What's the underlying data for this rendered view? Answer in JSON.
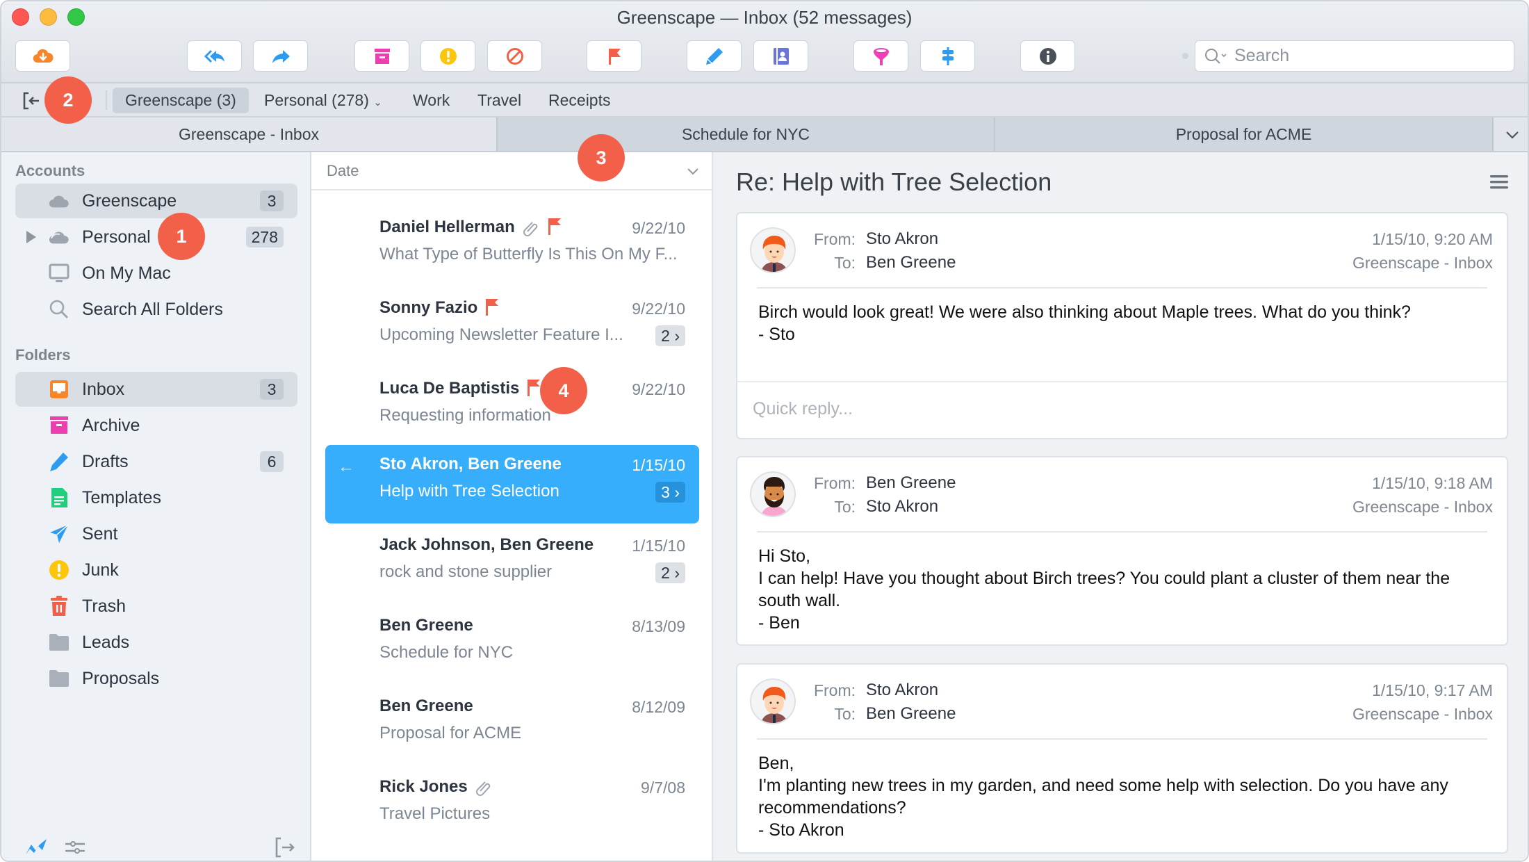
{
  "window": {
    "title": "Greenscape — Inbox (52 messages)"
  },
  "toolbar": {
    "buttons": [
      {
        "name": "get-mail",
        "icon": "cloud-download-icon",
        "color": "#f7862a"
      },
      {
        "name": "reply-all",
        "icon": "reply-all-icon",
        "color": "#2d9cf0"
      },
      {
        "name": "forward",
        "icon": "forward-icon",
        "color": "#2d9cf0"
      },
      {
        "name": "archive",
        "icon": "archive-icon",
        "color": "#ee3fb0"
      },
      {
        "name": "junk",
        "icon": "junk-icon",
        "color": "#fdc60a"
      },
      {
        "name": "block",
        "icon": "block-icon",
        "color": "#f2604a"
      },
      {
        "name": "flag",
        "icon": "flag-icon",
        "color": "#f2604a"
      },
      {
        "name": "compose",
        "icon": "pencil-icon",
        "color": "#2d9cf0"
      },
      {
        "name": "contacts",
        "icon": "contacts-icon",
        "color": "#6a75dc"
      },
      {
        "name": "filter",
        "icon": "filter-icon",
        "color": "#f040b8"
      },
      {
        "name": "tags",
        "icon": "signpost-icon",
        "color": "#2d9cf0"
      },
      {
        "name": "info",
        "icon": "info-icon",
        "color": "#4a5058"
      }
    ],
    "search_placeholder": "Search"
  },
  "favorites": {
    "items": [
      {
        "label": "Greenscape (3)",
        "active": true
      },
      {
        "label": "Personal (278)",
        "dropdown": true
      },
      {
        "label": "Work"
      },
      {
        "label": "Travel"
      },
      {
        "label": "Receipts"
      }
    ]
  },
  "tabs": [
    {
      "label": "Greenscape - Inbox",
      "active": true
    },
    {
      "label": "Schedule for NYC"
    },
    {
      "label": "Proposal for ACME"
    }
  ],
  "sidebar": {
    "accounts_header": "Accounts",
    "accounts": [
      {
        "label": "Greenscape",
        "count": "3",
        "selected": true,
        "icon": "cloud-icon"
      },
      {
        "label": "Personal",
        "count": "278",
        "icon": "cloud-icon",
        "expandable": true
      },
      {
        "label": "On My Mac",
        "icon": "computer-icon"
      },
      {
        "label": "Search All Folders",
        "icon": "search-icon"
      }
    ],
    "folders_header": "Folders",
    "folders": [
      {
        "label": "Inbox",
        "count": "3",
        "selected": true,
        "icon": "inbox-icon"
      },
      {
        "label": "Archive",
        "icon": "archive-icon"
      },
      {
        "label": "Drafts",
        "count": "6",
        "icon": "pencil-icon"
      },
      {
        "label": "Templates",
        "icon": "template-icon"
      },
      {
        "label": "Sent",
        "icon": "paper-plane-icon"
      },
      {
        "label": "Junk",
        "icon": "junk-icon"
      },
      {
        "label": "Trash",
        "icon": "trash-icon"
      },
      {
        "label": "Leads",
        "icon": "folder-icon"
      },
      {
        "label": "Proposals",
        "icon": "folder-icon"
      }
    ]
  },
  "list": {
    "sort_label": "Date",
    "items": [
      {
        "sender": "Daniel Hellerman",
        "subject": "What Type of Butterfly Is This On My F...",
        "date": "9/22/10",
        "attachment": true,
        "flagged": true
      },
      {
        "sender": "Sonny Fazio",
        "subject": "Upcoming Newsletter Feature I...",
        "date": "9/22/10",
        "flagged": true,
        "thread_count": "2"
      },
      {
        "sender": "Luca De Baptistis",
        "subject": "Requesting information",
        "date": "9/22/10",
        "flagged": true
      },
      {
        "sender": "Sto Akron, Ben Greene",
        "subject": "Help with Tree Selection",
        "date": "1/15/10",
        "thread_count": "3",
        "selected": true,
        "replied": true
      },
      {
        "sender": "Jack Johnson, Ben Greene",
        "subject": "rock and stone supplier",
        "date": "1/15/10",
        "thread_count": "2"
      },
      {
        "sender": "Ben Greene",
        "subject": "Schedule for NYC",
        "date": "8/13/09"
      },
      {
        "sender": "Ben Greene",
        "subject": "Proposal for ACME",
        "date": "8/12/09"
      },
      {
        "sender": "Rick Jones",
        "subject": "Travel Pictures",
        "date": "9/7/08",
        "attachment": true
      }
    ]
  },
  "reader": {
    "title": "Re: Help with Tree Selection",
    "from_label": "From:",
    "to_label": "To:",
    "quick_reply_placeholder": "Quick reply...",
    "messages": [
      {
        "from": "Sto Akron",
        "to": "Ben Greene",
        "date": "1/15/10, 9:20 AM",
        "folder": "Greenscape - Inbox",
        "avatar": "redhead",
        "body": "Birch would look great!  We were also thinking about Maple trees.  What do you think?\n- Sto"
      },
      {
        "from": "Ben Greene",
        "to": "Sto Akron",
        "date": "1/15/10, 9:18 AM",
        "folder": "Greenscape - Inbox",
        "avatar": "bearded",
        "body": "Hi Sto,\nI can help!  Have you thought about Birch trees?  You could plant a cluster of them near the south wall.\n- Ben"
      },
      {
        "from": "Sto Akron",
        "to": "Ben Greene",
        "date": "1/15/10, 9:17 AM",
        "folder": "Greenscape - Inbox",
        "avatar": "redhead",
        "body": "Ben,\nI'm planting new trees in my garden, and need some help with selection.  Do you have any recommendations?\n- Sto Akron"
      }
    ]
  },
  "callouts": [
    "1",
    "2",
    "3",
    "4"
  ],
  "colors": {
    "accent": "#36aefc",
    "callout": "#f2604a",
    "flag": "#f2604a"
  }
}
